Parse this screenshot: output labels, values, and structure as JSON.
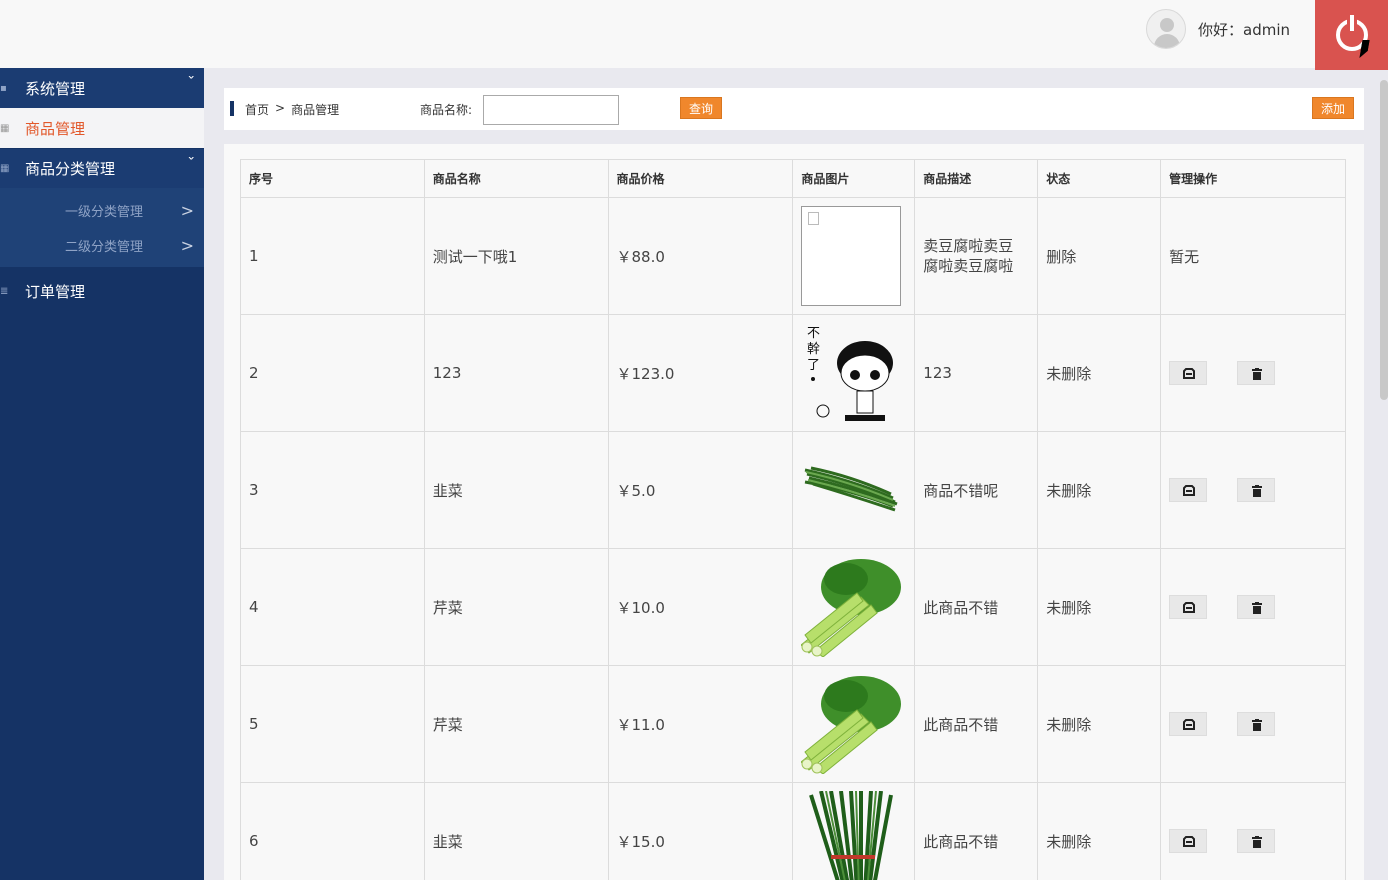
{
  "header": {
    "greeting": "你好：admin"
  },
  "sidebar": {
    "items": [
      {
        "label": "系统管理",
        "icon": "settings-icon"
      },
      {
        "label": "商品管理",
        "icon": "grid-icon"
      },
      {
        "label": "商品分类管理",
        "icon": "grid-icon"
      },
      {
        "label": "订单管理",
        "icon": "list-icon"
      }
    ],
    "subitems": [
      {
        "label": "一级分类管理"
      },
      {
        "label": "二级分类管理"
      }
    ]
  },
  "toolbar": {
    "breadcrumb_home": "首页",
    "breadcrumb_sep": ">",
    "breadcrumb_current": "商品管理",
    "search_label": "商品名称:",
    "search_value": "",
    "query_label": "查询",
    "add_label": "添加"
  },
  "table": {
    "headers": [
      "序号",
      "商品名称",
      "商品价格",
      "商品图片",
      "商品描述",
      "状态",
      "管理操作"
    ],
    "rows": [
      {
        "id": "1",
        "name": "测试一下哦1",
        "price": "￥88.0",
        "image": "broken",
        "desc": "卖豆腐啦卖豆腐啦卖豆腐啦",
        "status": "删除",
        "ops": "暂无"
      },
      {
        "id": "2",
        "name": "123",
        "price": "￥123.0",
        "image": "cartoon",
        "desc": "123",
        "status": "未删除",
        "ops": ""
      },
      {
        "id": "3",
        "name": "韭菜",
        "price": "￥5.0",
        "image": "chives",
        "desc": "商品不错呢",
        "status": "未删除",
        "ops": ""
      },
      {
        "id": "4",
        "name": "芹菜",
        "price": "￥10.0",
        "image": "celery",
        "desc": "此商品不错",
        "status": "未删除",
        "ops": ""
      },
      {
        "id": "5",
        "name": "芹菜",
        "price": "￥11.0",
        "image": "celery",
        "desc": "此商品不错",
        "status": "未删除",
        "ops": ""
      },
      {
        "id": "6",
        "name": "韭菜",
        "price": "￥15.0",
        "image": "chives-bundle",
        "desc": "此商品不错",
        "status": "未删除",
        "ops": ""
      }
    ]
  },
  "colors": {
    "sidebar": "#153365",
    "accent": "#f0872c",
    "logout": "#d9534f",
    "active_text": "#e2582a"
  }
}
